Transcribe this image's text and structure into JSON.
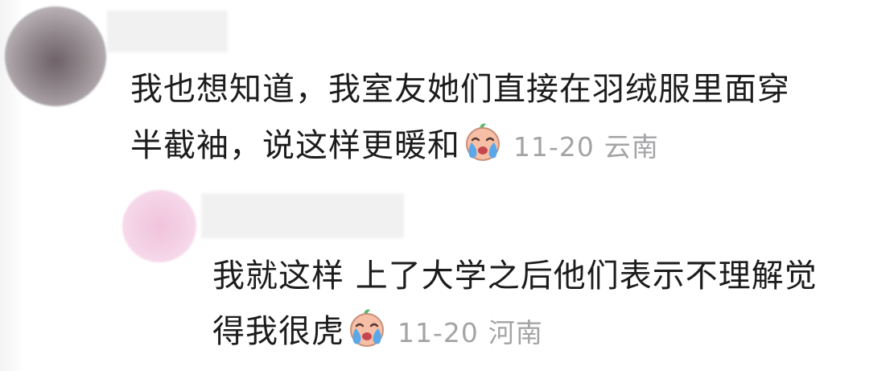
{
  "comment": {
    "text_line1": "我也想知道，我室友她们直接在羽绒服里面穿",
    "text_line2": "半截袖，说这样更暖和",
    "emoji_icon": "crying-face-icon",
    "date": "11-20",
    "location": "云南"
  },
  "reply": {
    "text_line1": "我就这样 上了大学之后他们表示不理解觉",
    "text_line2": "得我很虎",
    "emoji_icon": "crying-face-icon",
    "date": "11-20",
    "location": "河南"
  }
}
